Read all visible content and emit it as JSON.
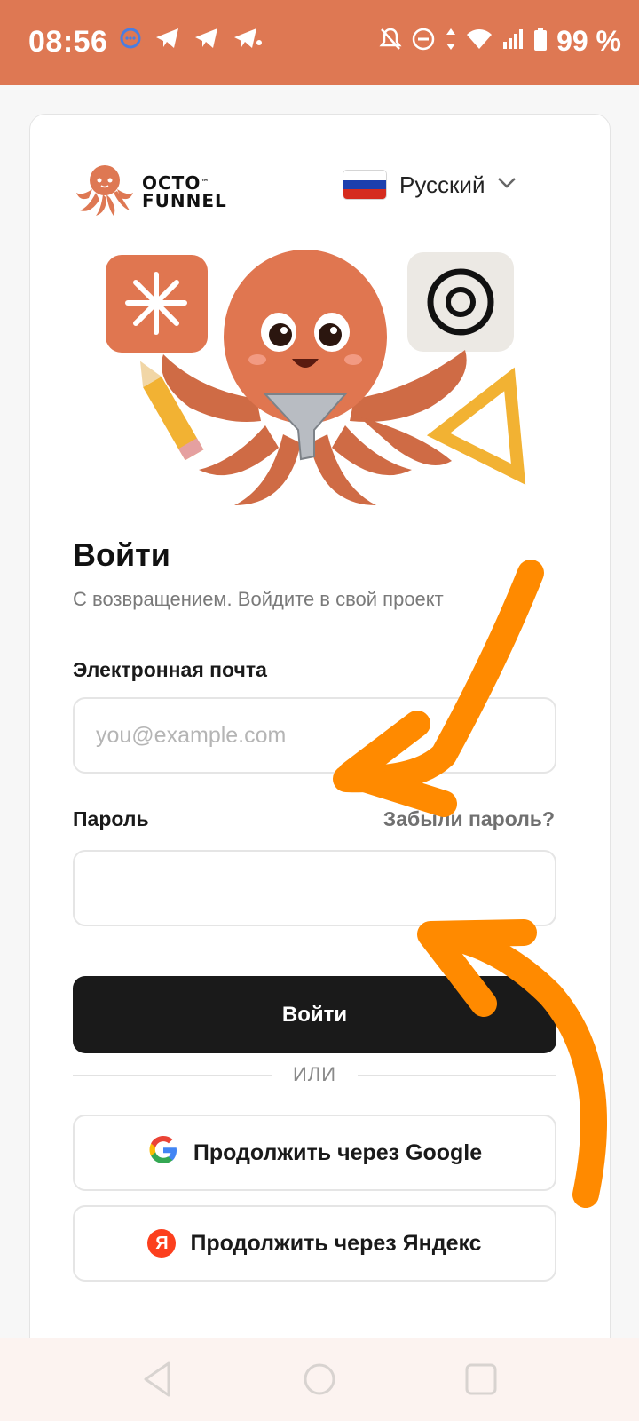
{
  "status_bar": {
    "time": "08:56",
    "battery_text": "99 %",
    "background_color": "#de7853",
    "icons_left": [
      "messenger-icon",
      "telegram-icon",
      "telegram-icon",
      "telegram-icon"
    ],
    "icons_right": [
      "mute-icon",
      "do-not-disturb-icon",
      "data-arrows-icon",
      "wifi-icon",
      "signal-icon",
      "battery-icon"
    ]
  },
  "brand": {
    "logo_line1": "OCTO",
    "logo_line2": "FUNNEL",
    "logo_tm": "™",
    "accent_color": "#de7853"
  },
  "language": {
    "selected": "Русский",
    "flag": "russia-flag-icon"
  },
  "login": {
    "title": "Войти",
    "subtitle": "С возвращением. Войдите в свой проект",
    "email_label": "Электронная почта",
    "email_placeholder": "you@example.com",
    "email_value": "",
    "password_label": "Пароль",
    "password_value": "",
    "forgot_link": "Забыли пароль?",
    "submit_label": "Войти",
    "divider_text": "ИЛИ",
    "google_button": "Продолжить через Google",
    "yandex_button": "Продолжить через Яндекс",
    "yandex_letter": "Я"
  },
  "annotation_color": "#ff8a00",
  "nav_bar": {
    "buttons": [
      "back-icon",
      "home-icon",
      "recents-icon"
    ]
  }
}
